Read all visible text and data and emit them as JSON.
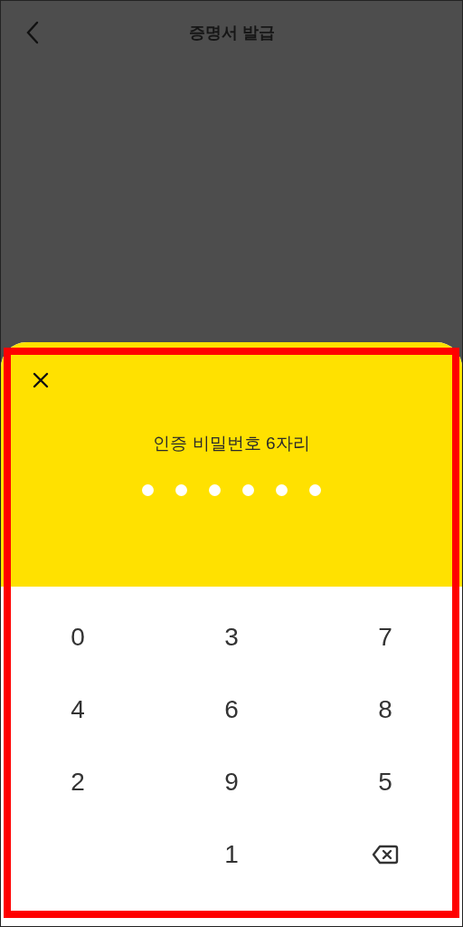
{
  "header": {
    "title": "증명서 발급"
  },
  "sheet": {
    "prompt": "인증 비밀번호 6자리",
    "pin_dots": [
      {
        "filled": false
      },
      {
        "filled": false
      },
      {
        "filled": false
      },
      {
        "filled": false
      },
      {
        "filled": false
      },
      {
        "filled": false
      }
    ]
  },
  "keypad": [
    {
      "kind": "digit",
      "label": "0"
    },
    {
      "kind": "digit",
      "label": "3"
    },
    {
      "kind": "digit",
      "label": "7"
    },
    {
      "kind": "digit",
      "label": "4"
    },
    {
      "kind": "digit",
      "label": "6"
    },
    {
      "kind": "digit",
      "label": "8"
    },
    {
      "kind": "digit",
      "label": "2"
    },
    {
      "kind": "digit",
      "label": "9"
    },
    {
      "kind": "digit",
      "label": "5"
    },
    {
      "kind": "blank"
    },
    {
      "kind": "digit",
      "label": "1"
    },
    {
      "kind": "backspace"
    }
  ],
  "highlight": {
    "shown": true
  }
}
